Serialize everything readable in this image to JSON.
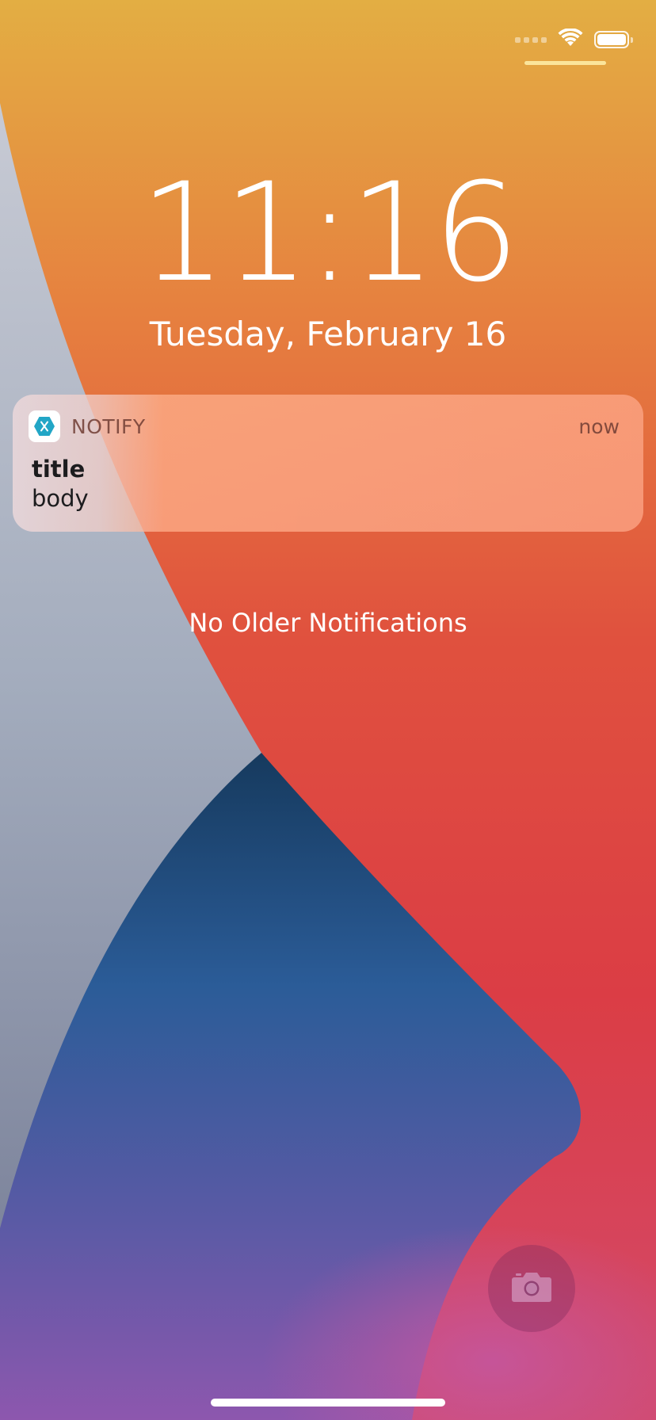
{
  "status_bar": {
    "wifi_icon": "wifi-icon",
    "battery_icon": "battery-icon",
    "battery_level": 1.0
  },
  "lock_screen": {
    "time": "11:16",
    "date": "Tuesday, February 16"
  },
  "notification": {
    "app_icon": "xamarin-app-icon",
    "app_name": "NOTIFY",
    "time": "now",
    "title": "title",
    "body": "body"
  },
  "no_older_notifications": "No Older Notifications",
  "camera": {
    "icon": "camera-icon"
  },
  "colors": {
    "wallpaper_top": "#e3ae43",
    "wallpaper_red": "#db3f42",
    "wallpaper_silver": "#aab4c8",
    "wallpaper_blue": "#2b5b94",
    "wallpaper_purple": "#9a5aaa",
    "app_icon_accent": "#22a6c6"
  }
}
